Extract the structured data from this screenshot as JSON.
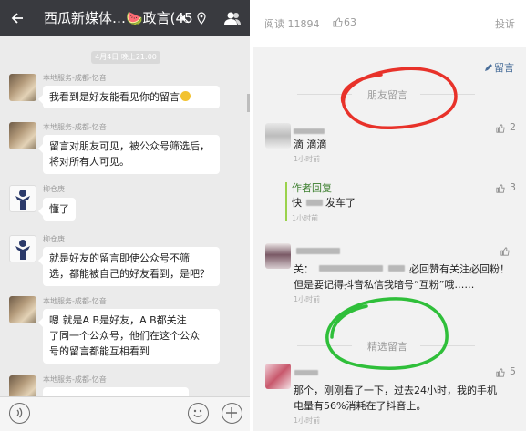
{
  "chat": {
    "title": "西瓜新媒体…🍉政言(45",
    "timestamp": "4月4日 晚上21:00",
    "messages": [
      {
        "sender": "本地服务-成都-忆音",
        "text": "我看到是好友能看见你的留言"
      },
      {
        "sender": "本地服务-成都-忆音",
        "lines": [
          "留言对朋友可见，被公众号筛选后，",
          "将对所有人可见。"
        ]
      },
      {
        "sender": "柳仓庚",
        "text": "懂了"
      },
      {
        "sender": "柳仓庚",
        "lines": [
          "就是好友的留言即使公众号不筛",
          "选，都能被自己的好友看到，是吧？"
        ]
      },
      {
        "sender": "本地服务-成都-忆音",
        "lines": [
          "嗯  就是A B是好友，A B都关注",
          "了同一个公众号，他们在这个公众",
          "号的留言都能互相看到"
        ]
      },
      {
        "sender": "本地服务-成都-忆音"
      }
    ],
    "icons": [
      "back-arrow-icon",
      "mute-icon",
      "location-icon",
      "group-icon",
      "voice-icon",
      "emoji-icon",
      "plus-icon"
    ]
  },
  "article": {
    "reads_label": "阅读 11894",
    "likes_label": "63",
    "report_label": "投诉",
    "write_label": "留言",
    "friends_section": "朋友留言",
    "selected_section": "精选留言",
    "comments": [
      {
        "like_count": "2",
        "text": "滴    滴滴",
        "time": "1小时前"
      },
      {
        "author_reply_label": "作者回复",
        "like_count": "3",
        "text": "发车了",
        "text_prefix": "快",
        "time": "1小时前"
      },
      {
        "like_count": "",
        "line1_prefix": "关：",
        "line1_suffix": "必回赞有关注必回粉！",
        "line2": "但是要记得抖音私信我暗号“互粉”哦……",
        "time": "1小时前"
      },
      {
        "like_count": "5",
        "lines": [
          "那个，刚刚看了一下，过去24小时，我的手机",
          "电量有56%消耗在了抖音上。"
        ],
        "time": "1小时前"
      }
    ],
    "annotation_colors": {
      "red": "#e8322a",
      "green": "#2fbf3a"
    }
  }
}
